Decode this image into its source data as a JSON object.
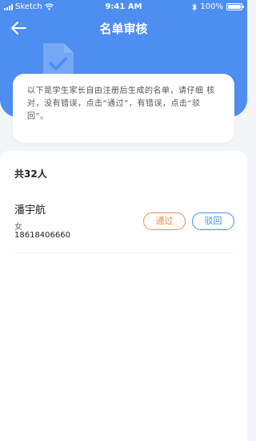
{
  "status_bar": {
    "carrier": "Sketch",
    "time": "9:41 AM",
    "battery": "100%"
  },
  "header": {
    "title": "名单审核"
  },
  "notice": {
    "text": "以下是学生家长自由注册后生成的名单，请仔细 核对，没有错误，点击“通过”，有错误，点击“驳回”。"
  },
  "list": {
    "count_label": "共32人",
    "items": [
      {
        "name": "潘宇航",
        "gender": "女",
        "phone": "18618406660",
        "pass_label": "通过",
        "reject_label": "驳回"
      }
    ]
  },
  "colors": {
    "primary": "#4d8ef0",
    "pass": "#f08a4b"
  }
}
